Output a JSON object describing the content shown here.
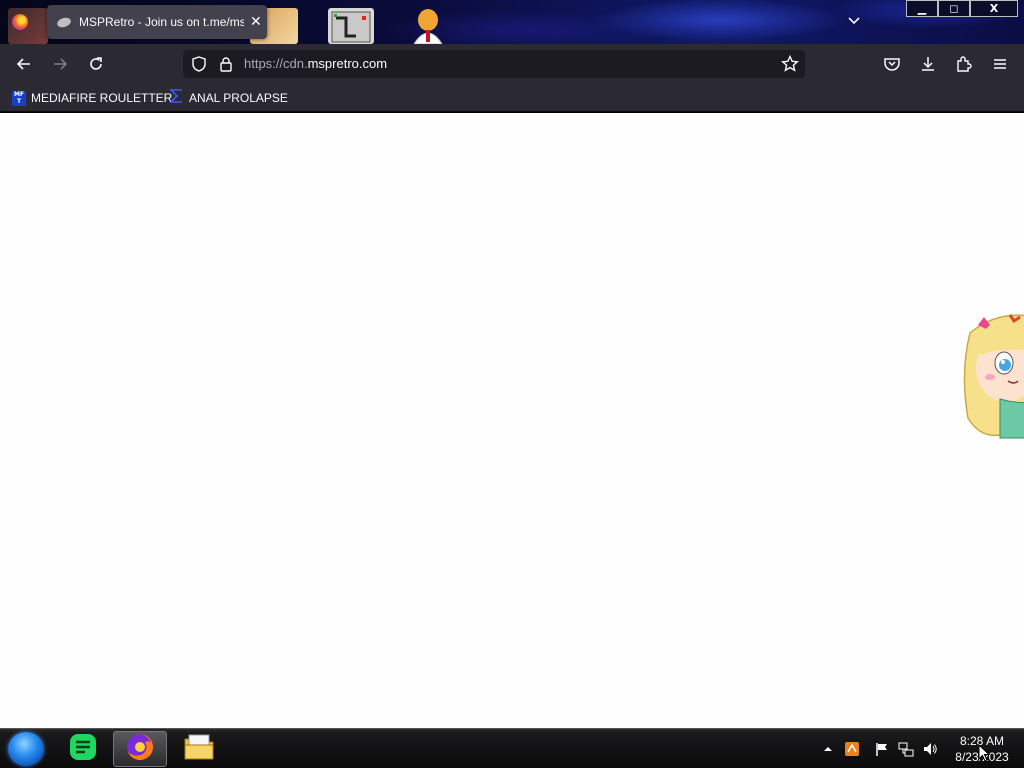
{
  "tab": {
    "title": "MSPRetro - Join us on t.me/ms",
    "close": "✕"
  },
  "window_controls": {
    "minimize": "▁",
    "maximize": "◻",
    "close": "X"
  },
  "navigation": {
    "url_prefix": "https://cdn.",
    "url_domain": "mspretro.com"
  },
  "bookmarks": [
    {
      "label": "MEDIAFIRE ROULETTER",
      "icon": "mediafire-icon",
      "icon_text": "MF T"
    },
    {
      "label": "ANAL PROLAPSE",
      "icon": "sigma-icon"
    }
  ],
  "taskbar": {
    "apps": [
      "start-orb",
      "notes-icon",
      "firefox-icon",
      "file-explorer-icon"
    ],
    "time": "8:28 AM",
    "date": "8/23/2023"
  },
  "colors": {
    "toolbar": "#2b2a33",
    "urlbar": "#1c1b22",
    "tab": "#42414d",
    "content": "#fefefe"
  }
}
